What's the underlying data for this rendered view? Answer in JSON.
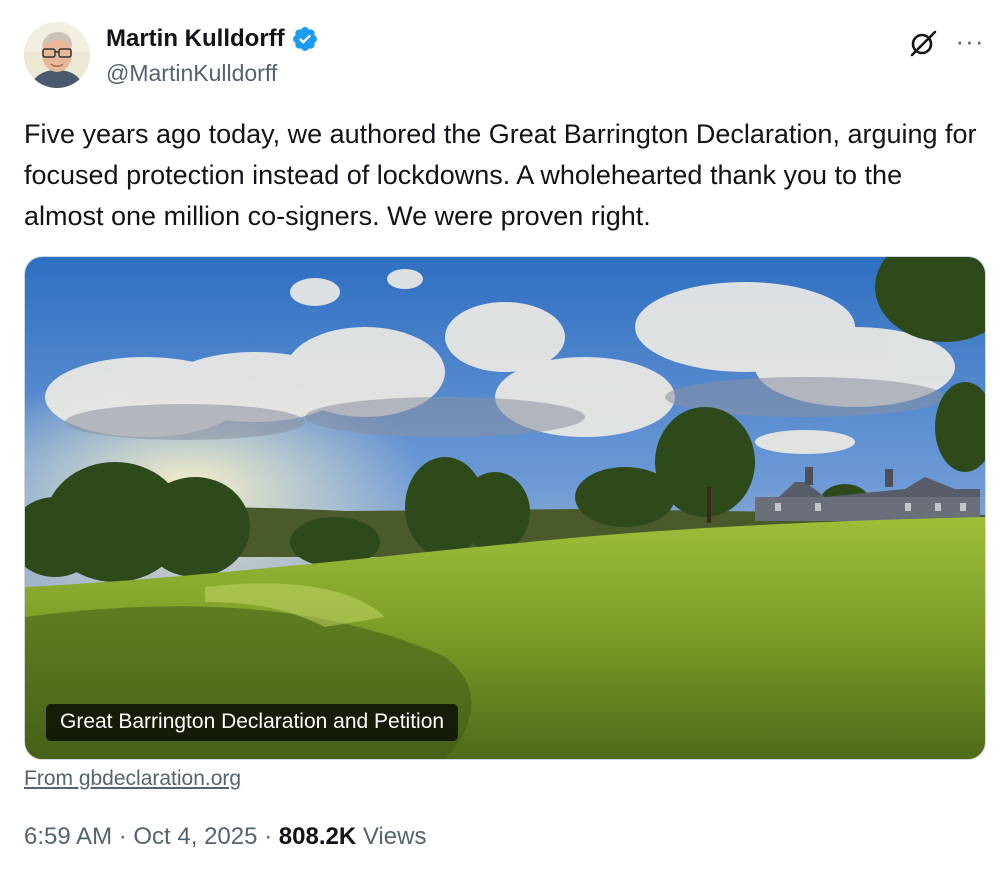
{
  "author": {
    "display_name": "Martin Kulldorff",
    "handle": "@MartinKulldorff",
    "verified": true,
    "verified_color": "#1d9bf0",
    "avatar_icon": "profile-photo"
  },
  "header_actions": {
    "grok_icon": "grok-icon",
    "more_icon": "more-horizontal-icon",
    "more_label": "···"
  },
  "tweet": {
    "text": "Five years ago today, we authored the Great Barrington Declaration, arguing for focused protection instead of lockdowns. A wholehearted thank you to the almost one million co-signers. We were proven right."
  },
  "link_card": {
    "image_subject": "landscape-photo",
    "caption": "Great Barrington Declaration and Petition",
    "source": "From gbdeclaration.org"
  },
  "meta": {
    "time": "6:59 AM",
    "separator": " · ",
    "date": "Oct 4, 2025",
    "views_count": "808.2K",
    "views_label": " Views"
  },
  "colors": {
    "text_primary": "#0f1419",
    "text_secondary": "#536471",
    "border": "#cfd9de"
  }
}
